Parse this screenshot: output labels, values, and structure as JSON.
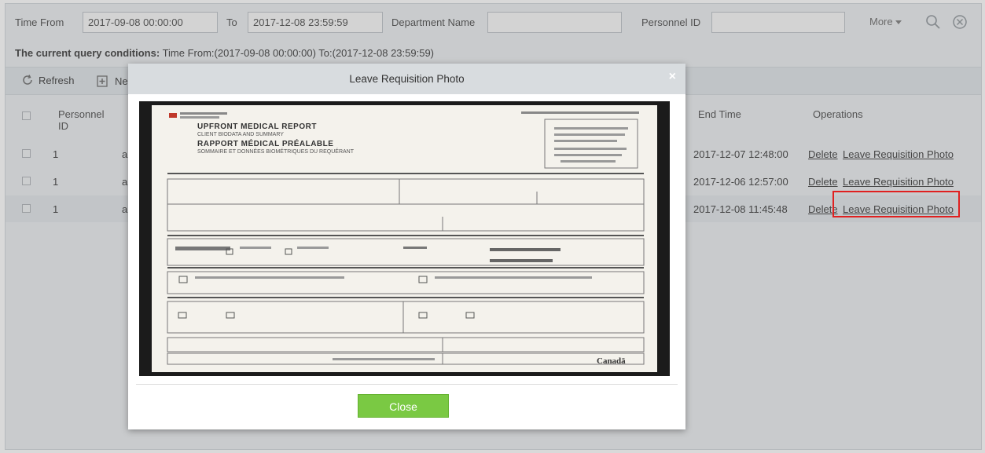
{
  "filter": {
    "time_from_label": "Time From",
    "time_from_value": "2017-09-08 00:00:00",
    "to_label": "To",
    "to_value": "2017-12-08 23:59:59",
    "department_label": "Department Name",
    "department_value": "",
    "personnel_label": "Personnel ID",
    "personnel_value": "",
    "more_label": "More",
    "search_icon": "search-icon",
    "clear_icon": "clear-icon"
  },
  "query": {
    "prefix": "The current query conditions:",
    "text": "Time From:(2017-09-08 00:00:00)  To:(2017-12-08 23:59:59)"
  },
  "toolbar": {
    "refresh_label": "Refresh",
    "new_label": "Ne"
  },
  "table": {
    "headers": {
      "personnel_id_1": "Personnel",
      "personnel_id_2": "ID",
      "end_time": "End Time",
      "operations": "Operations"
    },
    "rows": [
      {
        "id": "1",
        "name": "a",
        "end_time": "2017-12-07 12:48:00",
        "delete": "Delete",
        "photo": "Leave Requisition Photo"
      },
      {
        "id": "1",
        "name": "a",
        "end_time": "2017-12-06 12:57:00",
        "delete": "Delete",
        "photo": "Leave Requisition Photo"
      },
      {
        "id": "1",
        "name": "a",
        "end_time": "2017-12-08 11:45:48",
        "delete": "Delete",
        "photo": "Leave Requisition Photo"
      }
    ]
  },
  "modal": {
    "title": "Leave Requisition Photo",
    "close_x": "×",
    "close_button": "Close",
    "doc": {
      "title1": "UPFRONT MEDICAL REPORT",
      "subtitle1": "CLIENT BIODATA AND SUMMARY",
      "title2": "RAPPORT MÉDICAL PRÉALABLE",
      "subtitle2": "SOMMAIRE ET DONNÉES BIOMÉTRIQUES DU REQUÉRANT",
      "signature": "Canadä"
    }
  },
  "colors": {
    "accent_green": "#7ac943",
    "highlight_red": "#e02020"
  }
}
